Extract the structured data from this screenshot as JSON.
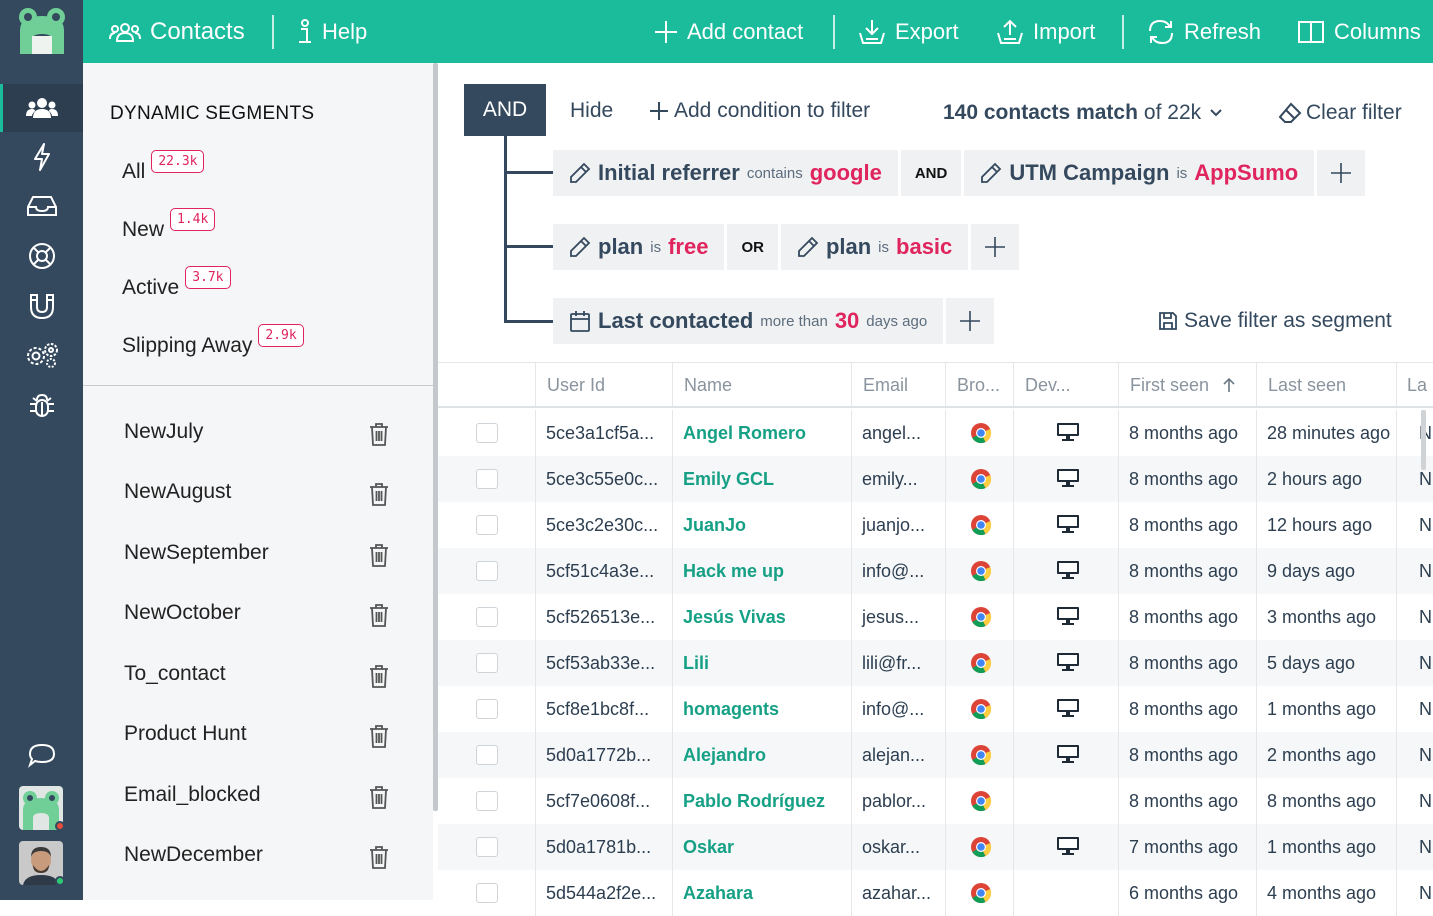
{
  "topbar": {
    "title": "Contacts",
    "help": "Help",
    "add_contact": "Add contact",
    "export": "Export",
    "import": "Import",
    "refresh": "Refresh",
    "columns": "Columns"
  },
  "rail": {
    "items": [
      "contacts-icon",
      "bolt-icon",
      "inbox-icon",
      "lifebuoy-icon",
      "magnet-icon",
      "settings-icon",
      "bug-icon"
    ],
    "active": "contacts-icon",
    "bottom": [
      "chat-icon",
      "workspace-avatar",
      "user-avatar"
    ]
  },
  "sidebar": {
    "dynamic_title": "DYNAMIC SEGMENTS",
    "dynamic": [
      {
        "label": "All",
        "count": "22.3k"
      },
      {
        "label": "New",
        "count": "1.4k"
      },
      {
        "label": "Active",
        "count": "3.7k"
      },
      {
        "label": "Slipping Away",
        "count": "2.9k"
      }
    ],
    "segments": [
      "NewJuly",
      "NewAugust",
      "NewSeptember",
      "NewOctober",
      "To_contact",
      "Product Hunt",
      "Email_blocked",
      "NewDecember"
    ]
  },
  "filter": {
    "root_operator": "AND",
    "hide": "Hide",
    "add_condition": "Add condition to filter",
    "match_count": "140 contacts match",
    "match_total": "of 22k",
    "clear": "Clear filter",
    "save": "Save filter as segment",
    "groups": [
      {
        "conjunction": "AND",
        "conditions": [
          {
            "field": "Initial referrer",
            "op": "contains",
            "value": "google"
          },
          {
            "field": "UTM Campaign",
            "op": "is",
            "value": "AppSumo"
          }
        ]
      },
      {
        "conjunction": "OR",
        "conditions": [
          {
            "field": "plan",
            "op": "is",
            "value": "free"
          },
          {
            "field": "plan",
            "op": "is",
            "value": "basic"
          }
        ]
      },
      {
        "conditions": [
          {
            "field": "Last contacted",
            "op": "more than",
            "value": "30",
            "suffix": "days ago"
          }
        ]
      }
    ]
  },
  "table": {
    "columns": [
      "User Id",
      "Name",
      "Email",
      "Bro...",
      "Dev...",
      "First seen",
      "Last seen",
      "La"
    ],
    "sort_column": "First seen",
    "rows": [
      {
        "user_id": "5ce3a1cf5a...",
        "name": "Angel Romero",
        "email": "angel...",
        "browser": "chrome",
        "device": "desktop",
        "first_seen": "8 months ago",
        "last_seen": "28 minutes ago",
        "last": "N"
      },
      {
        "user_id": "5ce3c55e0c...",
        "name": "Emily GCL",
        "email": "emily...",
        "browser": "chrome",
        "device": "desktop",
        "first_seen": "8 months ago",
        "last_seen": "2 hours ago",
        "last": "N"
      },
      {
        "user_id": "5ce3c2e30c...",
        "name": "JuanJo",
        "email": "juanjo...",
        "browser": "chrome",
        "device": "desktop",
        "first_seen": "8 months ago",
        "last_seen": "12 hours ago",
        "last": "N"
      },
      {
        "user_id": "5cf51c4a3e...",
        "name": "Hack me up",
        "email": "info@...",
        "browser": "chrome",
        "device": "desktop",
        "first_seen": "8 months ago",
        "last_seen": "9 days ago",
        "last": "N"
      },
      {
        "user_id": "5cf526513e...",
        "name": "Jesús Vivas",
        "email": "jesus...",
        "browser": "chrome",
        "device": "desktop",
        "first_seen": "8 months ago",
        "last_seen": "3 months ago",
        "last": "N"
      },
      {
        "user_id": "5cf53ab33e...",
        "name": "Lili",
        "email": "lili@fr...",
        "browser": "chrome",
        "device": "desktop",
        "first_seen": "8 months ago",
        "last_seen": "5 days ago",
        "last": "N"
      },
      {
        "user_id": "5cf8e1bc8f...",
        "name": "homagents",
        "email": "info@...",
        "browser": "chrome",
        "device": "desktop",
        "first_seen": "8 months ago",
        "last_seen": "1 months ago",
        "last": "N"
      },
      {
        "user_id": "5d0a1772b...",
        "name": "Alejandro",
        "email": "alejan...",
        "browser": "chrome",
        "device": "desktop",
        "first_seen": "8 months ago",
        "last_seen": "2 months ago",
        "last": "N"
      },
      {
        "user_id": "5cf7e0608f...",
        "name": "Pablo Rodríguez",
        "email": "pablor...",
        "browser": "chrome",
        "device": "",
        "first_seen": "8 months ago",
        "last_seen": "8 months ago",
        "last": "N"
      },
      {
        "user_id": "5d0a1781b...",
        "name": "Oskar",
        "email": "oskar...",
        "browser": "chrome",
        "device": "desktop",
        "first_seen": "7 months ago",
        "last_seen": "1 months ago",
        "last": "N"
      },
      {
        "user_id": "5d544a2f2e...",
        "name": "Azahara",
        "email": "azahar...",
        "browser": "chrome",
        "device": "",
        "first_seen": "6 months ago",
        "last_seen": "4 months ago",
        "last": "N"
      }
    ]
  },
  "colors": {
    "brand": "#1abc9c",
    "rail": "#34495e",
    "accent": "#e0245e",
    "link": "#16a085"
  }
}
